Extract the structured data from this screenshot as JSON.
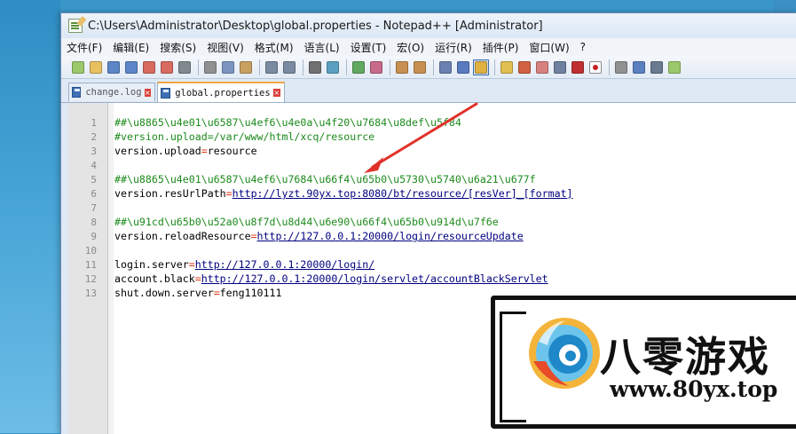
{
  "window": {
    "title": "C:\\Users\\Administrator\\Desktop\\global.properties - Notepad++ [Administrator]"
  },
  "menu": [
    "文件(F)",
    "编辑(E)",
    "搜索(S)",
    "视图(V)",
    "格式(M)",
    "语言(L)",
    "设置(T)",
    "宏(O)",
    "运行(R)",
    "插件(P)",
    "窗口(W)",
    "?"
  ],
  "tabs": [
    {
      "label": "change.log",
      "active": false
    },
    {
      "label": "global.properties",
      "active": true
    }
  ],
  "lines": [
    {
      "n": "1",
      "parts": [
        {
          "t": "##\\u8865\\u4e01\\u6587\\u4ef6\\u4e0a\\u4f20\\u7684\\u8def\\u5f84",
          "c": "comment"
        }
      ]
    },
    {
      "n": "2",
      "parts": [
        {
          "t": "#version.upload=/var/www/html/xcq/resource",
          "c": "comment"
        }
      ]
    },
    {
      "n": "3",
      "parts": [
        {
          "t": "version.upload",
          "c": "key"
        },
        {
          "t": "=",
          "c": "eq"
        },
        {
          "t": "resource",
          "c": "val"
        }
      ]
    },
    {
      "n": "4",
      "parts": []
    },
    {
      "n": "5",
      "parts": [
        {
          "t": "##\\u8865\\u4e01\\u6587\\u4ef6\\u7684\\u66f4\\u65b0\\u5730\\u5740\\u6a21\\u677f",
          "c": "comment"
        }
      ]
    },
    {
      "n": "6",
      "parts": [
        {
          "t": "version.resUrlPath",
          "c": "key"
        },
        {
          "t": "=",
          "c": "eq"
        },
        {
          "t": "http://lyzt.90yx.top:8080/bt/resource/[resVer]_[format]",
          "c": "link"
        }
      ]
    },
    {
      "n": "7",
      "parts": []
    },
    {
      "n": "8",
      "parts": [
        {
          "t": "##\\u91cd\\u65b0\\u52a0\\u8f7d\\u8d44\\u6e90\\u66f4\\u65b0\\u914d\\u7f6e",
          "c": "comment"
        }
      ]
    },
    {
      "n": "9",
      "parts": [
        {
          "t": "version.reloadResource",
          "c": "key"
        },
        {
          "t": "=",
          "c": "eq"
        },
        {
          "t": "http://127.0.0.1:20000/login/resourceUpdate",
          "c": "link"
        }
      ]
    },
    {
      "n": "10",
      "parts": []
    },
    {
      "n": "11",
      "parts": [
        {
          "t": "login.server",
          "c": "key"
        },
        {
          "t": "=",
          "c": "eq"
        },
        {
          "t": "http://127.0.0.1:20000/login/",
          "c": "link"
        }
      ]
    },
    {
      "n": "12",
      "parts": [
        {
          "t": "account.black",
          "c": "key"
        },
        {
          "t": "=",
          "c": "eq"
        },
        {
          "t": "http://127.0.0.1:20000/login/servlet/accountBlackServlet",
          "c": "link"
        }
      ]
    },
    {
      "n": "13",
      "parts": [
        {
          "t": "shut.down.server",
          "c": "key"
        },
        {
          "t": "=",
          "c": "eq"
        },
        {
          "t": "feng110111",
          "c": "val"
        }
      ]
    }
  ],
  "watermark": {
    "brand": "八零游戏",
    "url": "www.80yx.top"
  },
  "colors": {
    "comment": "#1c8a1c",
    "equals": "#e03a1a",
    "link": "#000080",
    "arrow": "#e0322a",
    "tab_accent": "#f2a640"
  },
  "toolbar_icons": [
    "new-file-icon",
    "open-file-icon",
    "save-icon",
    "save-all-icon",
    "close-icon",
    "close-all-icon",
    "print-icon",
    "cut-icon",
    "copy-icon",
    "paste-icon",
    "undo-icon",
    "redo-icon",
    "find-icon",
    "replace-icon",
    "zoom-in-icon",
    "zoom-out-icon",
    "sync-v-icon",
    "sync-h-icon",
    "word-wrap-icon",
    "show-all-chars-icon",
    "indent-guide-icon",
    "lang-icon",
    "doc-map-icon",
    "func-list-icon",
    "folder-workspace-icon",
    "monitor-icon",
    "record-macro-icon",
    "stop-macro-icon",
    "play-macro-icon",
    "run-macro-multi-icon",
    "save-macro-icon"
  ]
}
